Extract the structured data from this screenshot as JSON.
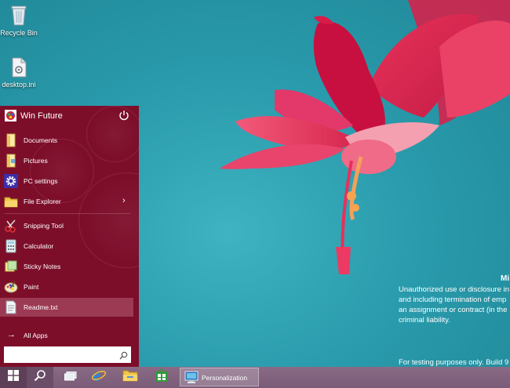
{
  "desktop": {
    "icons": [
      {
        "label": "Recycle Bin",
        "icon": "recycle-bin-icon"
      },
      {
        "label": "desktop.ini",
        "icon": "ini-file-icon"
      }
    ]
  },
  "watermark": {
    "title": "Mi",
    "lines": [
      "Unauthorized use or disclosure in",
      "and including termination of emp",
      "an assignment or contract (in the",
      "criminal liability."
    ],
    "build": "For testing purposes only. Build 9"
  },
  "start_menu": {
    "user_name": "Win Future",
    "power_icon": "power-icon",
    "pinned": [
      {
        "label": "Documents",
        "icon": "documents-folder-icon"
      },
      {
        "label": "Pictures",
        "icon": "pictures-folder-icon"
      },
      {
        "label": "PC settings",
        "icon": "gear-icon"
      },
      {
        "label": "File Explorer",
        "icon": "file-explorer-icon",
        "has_submenu": true
      }
    ],
    "recent": [
      {
        "label": "Snipping Tool",
        "icon": "snipping-tool-icon"
      },
      {
        "label": "Calculator",
        "icon": "calculator-icon"
      },
      {
        "label": "Sticky Notes",
        "icon": "sticky-notes-icon"
      },
      {
        "label": "Paint",
        "icon": "paint-icon"
      },
      {
        "label": "Readme.txt",
        "icon": "text-file-icon",
        "selected": true
      }
    ],
    "all_apps_label": "All Apps",
    "search_value": "",
    "search_placeholder": ""
  },
  "taskbar": {
    "buttons": [
      "windows-logo-icon",
      "search-icon",
      "task-view-icon",
      "internet-explorer-icon",
      "file-explorer-icon",
      "store-icon"
    ],
    "open_app": {
      "label": "Personalization",
      "icon": "personalization-icon"
    }
  },
  "colors": {
    "start_menu_bg": "#7d0e2a",
    "taskbar_bg": "#7a5c78",
    "desktop_bg": "#2a9cad",
    "accent_selected": "#9c3a53"
  }
}
